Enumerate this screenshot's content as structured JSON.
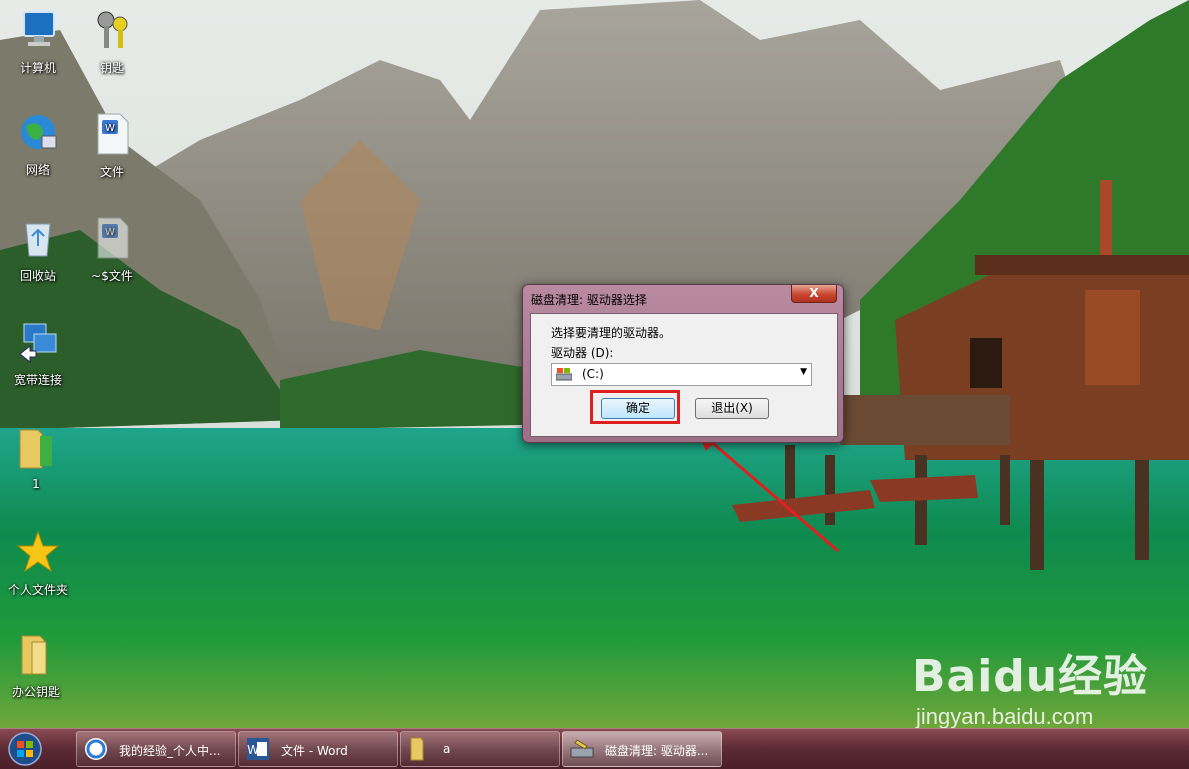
{
  "desktop": {
    "icons": [
      {
        "label": "计算机",
        "icon": "computer-icon"
      },
      {
        "label": "钥匙",
        "icon": "keys-icon"
      },
      {
        "label": "网络",
        "icon": "network-globe-icon"
      },
      {
        "label": "文件",
        "icon": "wps-document-icon"
      },
      {
        "label": "回收站",
        "icon": "recycle-bin-icon"
      },
      {
        "label": "~$文件",
        "icon": "wps-document-icon"
      },
      {
        "label": "宽带连接",
        "icon": "broadband-connection-icon"
      },
      {
        "label": "1",
        "icon": "folder-icon"
      },
      {
        "label": "个人文件夹",
        "icon": "star-icon"
      },
      {
        "label": "办公钥匙",
        "icon": "folder-icon"
      }
    ]
  },
  "dialog": {
    "title": "磁盘清理: 驱动器选择",
    "close_label": "X",
    "prompt": "选择要清理的驱动器。",
    "drive_label": "驱动器 (D):",
    "selected_drive": "(C:)",
    "ok_label": "确定",
    "exit_label": "退出(X)"
  },
  "taskbar": {
    "tasks": [
      {
        "label": "我的经验_个人中...",
        "icon": "browser-icon"
      },
      {
        "label": "文件 - Word",
        "icon": "word-icon"
      },
      {
        "label": "a",
        "icon": "folder-icon"
      },
      {
        "label": "磁盘清理: 驱动器...",
        "icon": "disk-cleanup-icon"
      }
    ]
  },
  "watermark": {
    "brand": "Baidu经验",
    "url": "jingyan.baidu.com"
  },
  "colors": {
    "annotation_red": "#e02020",
    "taskbar": "#5b2a33"
  }
}
